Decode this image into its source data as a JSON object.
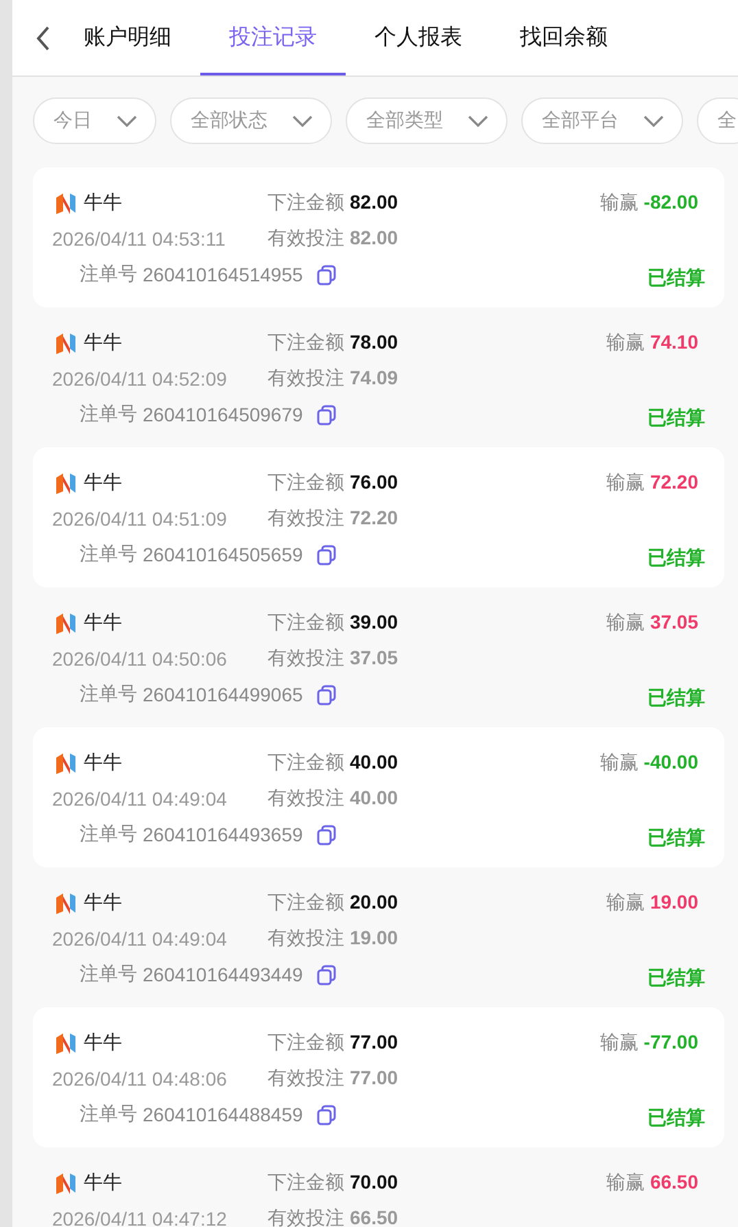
{
  "back": {
    "kind": "back"
  },
  "tabs": [
    {
      "label": "账户明细",
      "selected": false
    },
    {
      "label": "投注记录",
      "selected": true
    },
    {
      "label": "个人报表",
      "selected": false
    },
    {
      "label": "找回余额",
      "selected": false
    }
  ],
  "filters": [
    "今日",
    "全部状态",
    "全部类型",
    "全部平台",
    "全"
  ],
  "records": [
    {
      "game": "牛牛",
      "time": "2026/04/11 04:53:11",
      "bet_label": "下注金额",
      "bet": "82.00",
      "valid_label": "有效投注",
      "valid": "82.00",
      "order_label": "注单号",
      "order": "260410164514955",
      "win_label": "输赢",
      "win": "-82.00",
      "color": "#22b22a",
      "status": "已结算"
    },
    {
      "game": "牛牛",
      "time": "2026/04/11 04:52:09",
      "bet_label": "下注金额",
      "bet": "78.00",
      "valid_label": "有效投注",
      "valid": "74.09",
      "order_label": "注单号",
      "order": "260410164509679",
      "win_label": "输赢",
      "win": "74.10",
      "color": "#f03a6a",
      "status": "已结算"
    },
    {
      "game": "牛牛",
      "time": "2026/04/11 04:51:09",
      "bet_label": "下注金额",
      "bet": "76.00",
      "valid_label": "有效投注",
      "valid": "72.20",
      "order_label": "注单号",
      "order": "260410164505659",
      "win_label": "输赢",
      "win": "72.20",
      "color": "#f03a6a",
      "status": "已结算"
    },
    {
      "game": "牛牛",
      "time": "2026/04/11 04:50:06",
      "bet_label": "下注金额",
      "bet": "39.00",
      "valid_label": "有效投注",
      "valid": "37.05",
      "order_label": "注单号",
      "order": "260410164499065",
      "win_label": "输赢",
      "win": "37.05",
      "color": "#f03a6a",
      "status": "已结算"
    },
    {
      "game": "牛牛",
      "time": "2026/04/11 04:49:04",
      "bet_label": "下注金额",
      "bet": "40.00",
      "valid_label": "有效投注",
      "valid": "40.00",
      "order_label": "注单号",
      "order": "260410164493659",
      "win_label": "输赢",
      "win": "-40.00",
      "color": "#22b22a",
      "status": "已结算"
    },
    {
      "game": "牛牛",
      "time": "2026/04/11 04:49:04",
      "bet_label": "下注金额",
      "bet": "20.00",
      "valid_label": "有效投注",
      "valid": "19.00",
      "order_label": "注单号",
      "order": "260410164493449",
      "win_label": "输赢",
      "win": "19.00",
      "color": "#f03a6a",
      "status": "已结算"
    },
    {
      "game": "牛牛",
      "time": "2026/04/11 04:48:06",
      "bet_label": "下注金额",
      "bet": "77.00",
      "valid_label": "有效投注",
      "valid": "77.00",
      "order_label": "注单号",
      "order": "260410164488459",
      "win_label": "输赢",
      "win": "-77.00",
      "color": "#22b22a",
      "status": "已结算"
    },
    {
      "game": "牛牛",
      "time": "2026/04/11 04:47:12",
      "bet_label": "下注金额",
      "bet": "70.00",
      "valid_label": "有效投注",
      "valid": "66.50",
      "win_label": "输赢",
      "win": "66.50",
      "color": "#f03a6a"
    }
  ]
}
